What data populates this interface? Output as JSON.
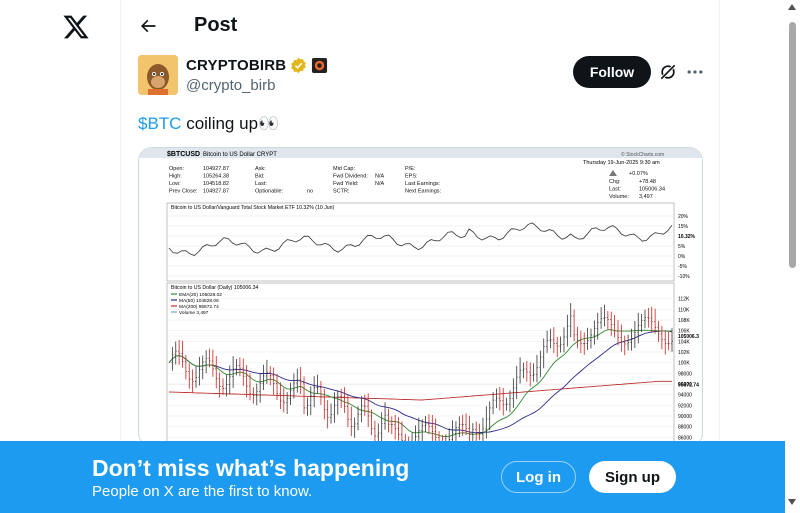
{
  "header": {
    "title": "Post"
  },
  "author": {
    "name": "CRYPTOBIRB",
    "handle": "@crypto_birb",
    "follow_label": "Follow"
  },
  "tweet": {
    "cashtag": "$BTC",
    "text": " coiling up",
    "emoji": "👀"
  },
  "chart_image": {
    "symbol": "$BTCUSD",
    "symbol_desc": "Bitcoin to US Dollar CRYPT",
    "source": "© StockCharts.com",
    "date": "Thursday 19-Jun-2025 9:30 am",
    "stats_left": [
      {
        "k": "Open:",
        "v": "104927.87"
      },
      {
        "k": "High:",
        "v": "105264.38"
      },
      {
        "k": "Low:",
        "v": "104518.82"
      },
      {
        "k": "Prev Close:",
        "v": "104927.87"
      }
    ],
    "stats_mid1": [
      "Ask:",
      "Bid:",
      "Last:",
      "Optionable:"
    ],
    "stats_mid1_extra": "no",
    "stats_mid2": [
      {
        "k": "Mid Cap:",
        "v": ""
      },
      {
        "k": "Fwd Dividend:",
        "v": "N/A"
      },
      {
        "k": "Fwd Yield:",
        "v": "N/A"
      },
      {
        "k": "SCTR:",
        "v": ""
      }
    ],
    "stats_mid3": [
      "P/E:",
      "EPS:",
      "Last Earnings:",
      "Next Earnings:"
    ],
    "stats_right": [
      {
        "k": "Chg:",
        "v": "+78.48"
      },
      {
        "k": "Last:",
        "v": "105006.34"
      },
      {
        "k": "Volume:",
        "v": "3,497"
      }
    ],
    "stats_right_pct": "+0.07%",
    "ratio_label": "Bitcoin to US Dollar/Vanguard Total Stock Market ETF 10.32% (10 Jun)",
    "ratio_ticks": [
      "20%",
      "15%",
      "10.32%",
      "5%",
      "0%",
      "-5%",
      "-10%"
    ],
    "main_label": "Bitcoin to US Dollar (Daily) 105006.34",
    "legend": [
      {
        "label": "EMA(20) 105028.02",
        "color": "#2e8b2e"
      },
      {
        "label": "MA(50) 104828.06",
        "color": "#2a2a8a"
      },
      {
        "label": "MA(200) 95872.74",
        "color": "#c03030"
      },
      {
        "label": "Volume 3,497",
        "color": "#7aa0c8"
      }
    ],
    "price_ticks": [
      "112K",
      "110K",
      "108K",
      "106K",
      "105006.3",
      "104K",
      "102K",
      "100K",
      "98000",
      "96000",
      "95872.74",
      "94000",
      "92000",
      "90000",
      "88000",
      "86000"
    ],
    "price_axis": [
      84000,
      114000
    ]
  },
  "banner": {
    "title": "Don’t miss what’s happening",
    "subtitle": "People on X are the first to know.",
    "login_label": "Log in",
    "signup_label": "Sign up"
  },
  "colors": {
    "accent": "#1d9bf0",
    "text": "#0f1419",
    "muted": "#536471"
  }
}
